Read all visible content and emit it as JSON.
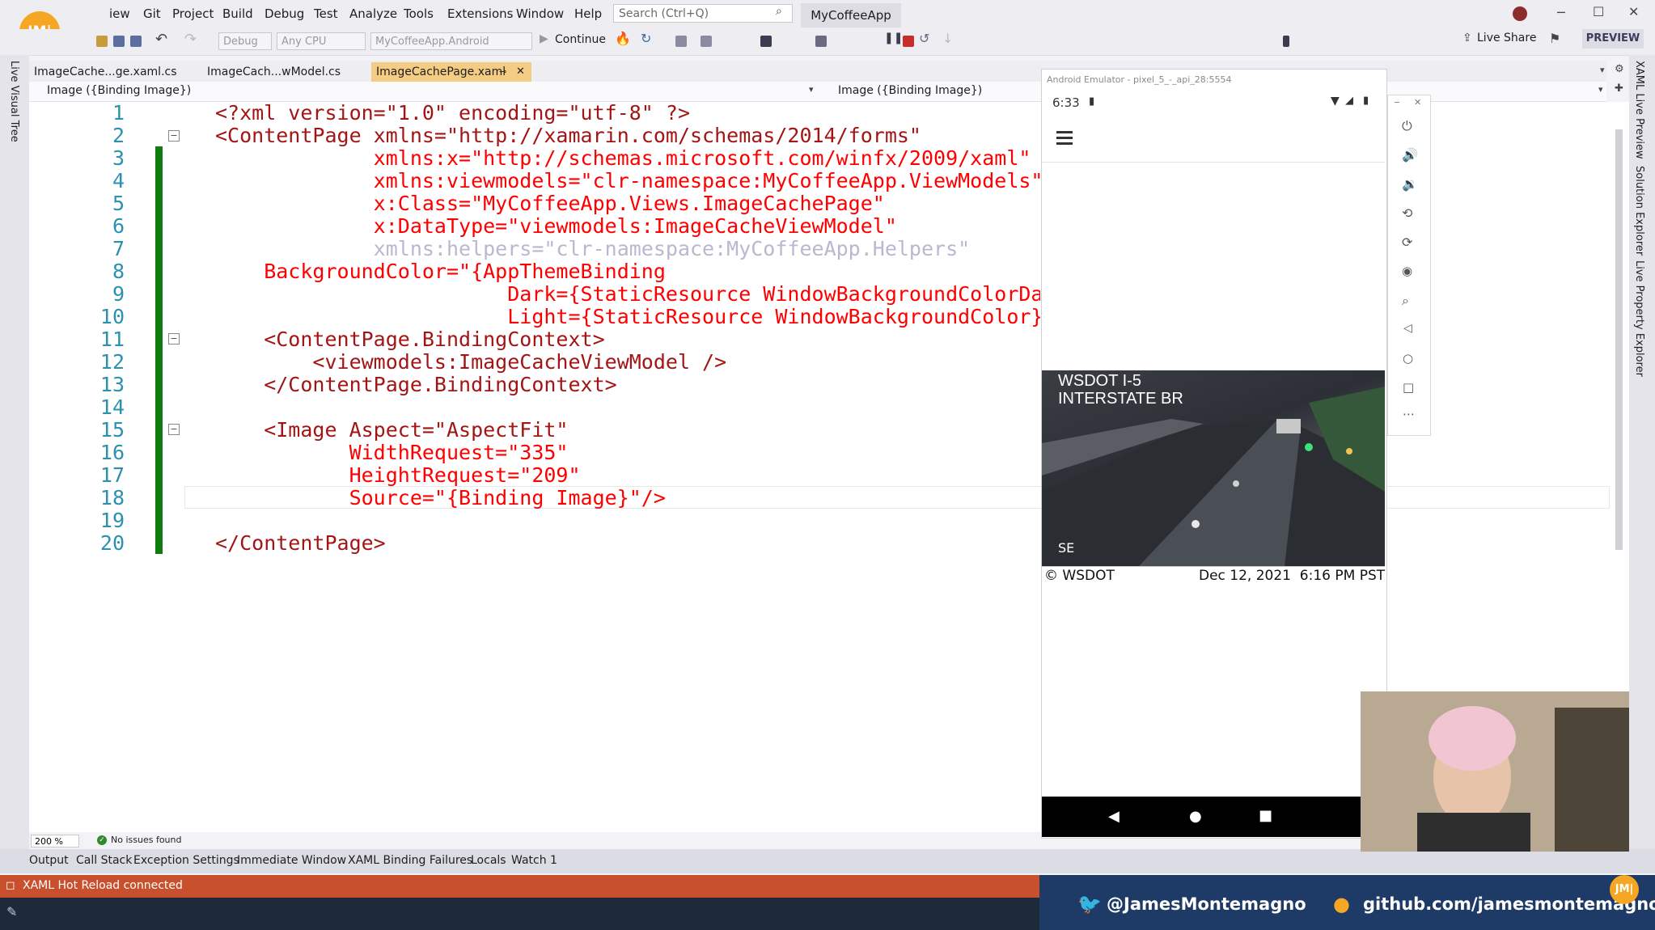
{
  "menu": {
    "items": [
      "iew",
      "Git",
      "Project",
      "Build",
      "Debug",
      "Test",
      "Analyze",
      "Tools",
      "Extensions",
      "Window",
      "Help"
    ],
    "search_placeholder": "Search (Ctrl+Q)",
    "solution_name": "MyCoffeeApp",
    "avatar_initials": "JM|"
  },
  "toolbar": {
    "configuration": "Debug",
    "platform": "Any CPU",
    "startup_project": "MyCoffeeApp.Android",
    "continue_label": "Continue",
    "live_share_label": "Live Share",
    "preview_label": "PREVIEW"
  },
  "tabs": [
    {
      "label": "ImageCache...ge.xaml.cs",
      "active": false
    },
    {
      "label": "ImageCach...wModel.cs",
      "active": false
    },
    {
      "label": "ImageCachePage.xaml",
      "active": true
    }
  ],
  "navbar": {
    "left_combo": "Image ({Binding Image})",
    "right_combo": "Image ({Binding Image})"
  },
  "side_panels": {
    "left": "Live Visual Tree",
    "right": [
      "XAML Live Preview",
      "Solution Explorer",
      "Live Property Explorer"
    ]
  },
  "code": {
    "lines": [
      {
        "n": "1",
        "text": "<?xml version=\"1.0\" encoding=\"utf-8\" ?>"
      },
      {
        "n": "2",
        "text": "<ContentPage xmlns=\"http://xamarin.com/schemas/2014/forms\""
      },
      {
        "n": "3",
        "text": "             xmlns:x=\"http://schemas.microsoft.com/winfx/2009/xaml\""
      },
      {
        "n": "4",
        "text": "             xmlns:viewmodels=\"clr-namespace:MyCoffeeApp.ViewModels\""
      },
      {
        "n": "5",
        "text": "             x:Class=\"MyCoffeeApp.Views.ImageCachePage\""
      },
      {
        "n": "6",
        "text": "             x:DataType=\"viewmodels:ImageCacheViewModel\""
      },
      {
        "n": "7",
        "text": "             xmlns:helpers=\"clr-namespace:MyCoffeeApp.Helpers\""
      },
      {
        "n": "8",
        "text": "    BackgroundColor=\"{AppThemeBinding"
      },
      {
        "n": "9",
        "text": "                        Dark={StaticResource WindowBackgroundColorDa"
      },
      {
        "n": "10",
        "text": "                        Light={StaticResource WindowBackgroundColor}"
      },
      {
        "n": "11",
        "text": "    <ContentPage.BindingContext>"
      },
      {
        "n": "12",
        "text": "        <viewmodels:ImageCacheViewModel />"
      },
      {
        "n": "13",
        "text": "    </ContentPage.BindingContext>"
      },
      {
        "n": "14",
        "text": ""
      },
      {
        "n": "15",
        "text": "    <Image Aspect=\"AspectFit\""
      },
      {
        "n": "16",
        "text": "           WidthRequest=\"335\""
      },
      {
        "n": "17",
        "text": "           HeightRequest=\"209\""
      },
      {
        "n": "18",
        "text": "           Source=\"{Binding Image}\"/>"
      },
      {
        "n": "19",
        "text": ""
      },
      {
        "n": "20",
        "text": "</ContentPage>"
      }
    ]
  },
  "editor_status": {
    "zoom": "200 %",
    "issues": "No issues found"
  },
  "bottom_tabs": [
    "Output",
    "Call Stack",
    "Exception Settings",
    "Immediate Window",
    "XAML Binding Failures",
    "Locals",
    "Watch 1"
  ],
  "status_bar": {
    "text": "XAML Hot Reload connected"
  },
  "emulator": {
    "title": "Android Emulator - pixel_5_-_api_28:5554",
    "time": "6:33",
    "camera_title_line1": "WSDOT I-5",
    "camera_title_line2": "INTERSTATE BR",
    "camera_direction": "SE",
    "camera_credit": "© WSDOT",
    "camera_timestamp": "Dec 12, 2021  6:16 PM PST"
  },
  "social": {
    "twitter": "@JamesMontemagno",
    "github": "github.com/jamesmontemagno"
  },
  "colors": {
    "accent": "#f5cc84",
    "status_bar": "#c9502d",
    "gutter_modified": "#107c10"
  }
}
